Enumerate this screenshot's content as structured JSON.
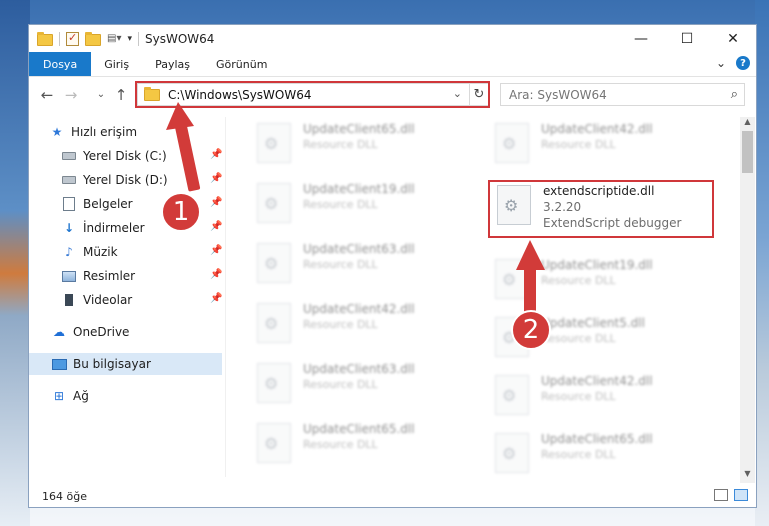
{
  "window": {
    "title": "SysWOW64",
    "controls": {
      "minimize": "—",
      "maximize": "☐",
      "close": "✕"
    }
  },
  "ribbon": {
    "tabs": [
      "Dosya",
      "Giriş",
      "Paylaş",
      "Görünüm"
    ],
    "expand": "⌄",
    "help": "?"
  },
  "toolbar": {
    "back": "←",
    "forward": "→",
    "recent": "⌄",
    "up": "↑",
    "address": "C:\\Windows\\SysWOW64",
    "address_dropdown": "⌄",
    "refresh": "↻",
    "search_placeholder": "Ara: SysWOW64",
    "search_icon": "⌕"
  },
  "sidebar": {
    "items": [
      {
        "label": "Hızlı erişim",
        "icon": "star-icon",
        "pinned": false
      },
      {
        "label": "Yerel Disk (C:)",
        "icon": "drive-icon",
        "pinned": true
      },
      {
        "label": "Yerel Disk (D:)",
        "icon": "drive-icon",
        "pinned": true
      },
      {
        "label": "Belgeler",
        "icon": "document-icon",
        "pinned": true
      },
      {
        "label": "İndirmeler",
        "icon": "download-icon",
        "pinned": true
      },
      {
        "label": "Müzik",
        "icon": "music-icon",
        "pinned": true
      },
      {
        "label": "Resimler",
        "icon": "pictures-icon",
        "pinned": true
      },
      {
        "label": "Videolar",
        "icon": "videos-icon",
        "pinned": true
      },
      {
        "label": "OneDrive",
        "icon": "onedrive-icon",
        "pinned": false
      },
      {
        "label": "Bu bilgisayar",
        "icon": "computer-icon",
        "pinned": false
      },
      {
        "label": "Ağ",
        "icon": "network-icon",
        "pinned": false
      }
    ],
    "pin_glyph": "📌"
  },
  "files": {
    "left": [
      {
        "name": "UpdateClient65.dll",
        "desc": "Resource DLL"
      },
      {
        "name": "UpdateClient19.dll",
        "desc": "Resource DLL"
      },
      {
        "name": "UpdateClient63.dll",
        "desc": "Resource DLL"
      },
      {
        "name": "UpdateClient42.dll",
        "desc": "Resource DLL"
      },
      {
        "name": "UpdateClient63.dll",
        "desc": "Resource DLL"
      },
      {
        "name": "UpdateClient65.dll",
        "desc": "Resource DLL"
      }
    ],
    "right": [
      {
        "name": "UpdateClient42.dll",
        "desc": "Resource DLL"
      },
      {
        "name": "UpdateClient19.dll",
        "desc": "Resource DLL"
      },
      {
        "name": "UpdateClient5.dll",
        "desc": "Resource DLL"
      },
      {
        "name": "UpdateClient42.dll",
        "desc": "Resource DLL"
      },
      {
        "name": "UpdateClient65.dll",
        "desc": "Resource DLL"
      }
    ],
    "highlighted": {
      "name": "extendscriptide.dll",
      "version": "3.2.20",
      "desc": "ExtendScript debugger"
    }
  },
  "status": {
    "count": "164 öğe"
  },
  "annotations": {
    "step1": "1",
    "step2": "2",
    "color": "#d23b39"
  }
}
